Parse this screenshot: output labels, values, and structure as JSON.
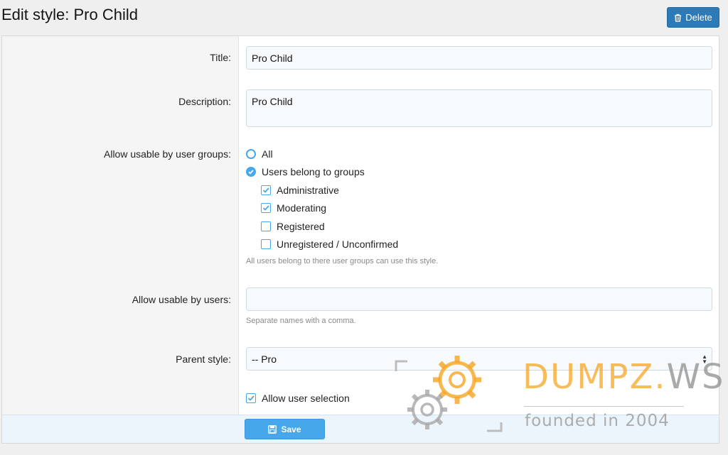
{
  "header": {
    "title": "Edit style: Pro Child",
    "delete_label": "Delete"
  },
  "form": {
    "title_label": "Title:",
    "title_value": "Pro Child",
    "description_label": "Description:",
    "description_value": "Pro Child",
    "groups_label": "Allow usable by user groups:",
    "radio_all": "All",
    "radio_groups": "Users belong to groups",
    "groups": [
      {
        "label": "Administrative",
        "checked": true
      },
      {
        "label": "Moderating",
        "checked": true
      },
      {
        "label": "Registered",
        "checked": false
      },
      {
        "label": "Unregistered / Unconfirmed",
        "checked": false
      }
    ],
    "groups_hint": "All users belong to there user groups can use this style.",
    "users_label": "Allow usable by users:",
    "users_value": "",
    "users_hint": "Separate names with a comma.",
    "parent_label": "Parent style:",
    "parent_value": "-- Pro",
    "allow_selection_label": "Allow user selection",
    "allow_selection_checked": true
  },
  "footer": {
    "save_label": "Save"
  },
  "watermark": {
    "brand_main": "DUMPZ.",
    "brand_suffix": "WS",
    "tagline": "founded in 2004"
  },
  "colors": {
    "accent": "#47a7eb",
    "delete_button": "#2d7ab8",
    "watermark_orange": "#f6a623"
  }
}
